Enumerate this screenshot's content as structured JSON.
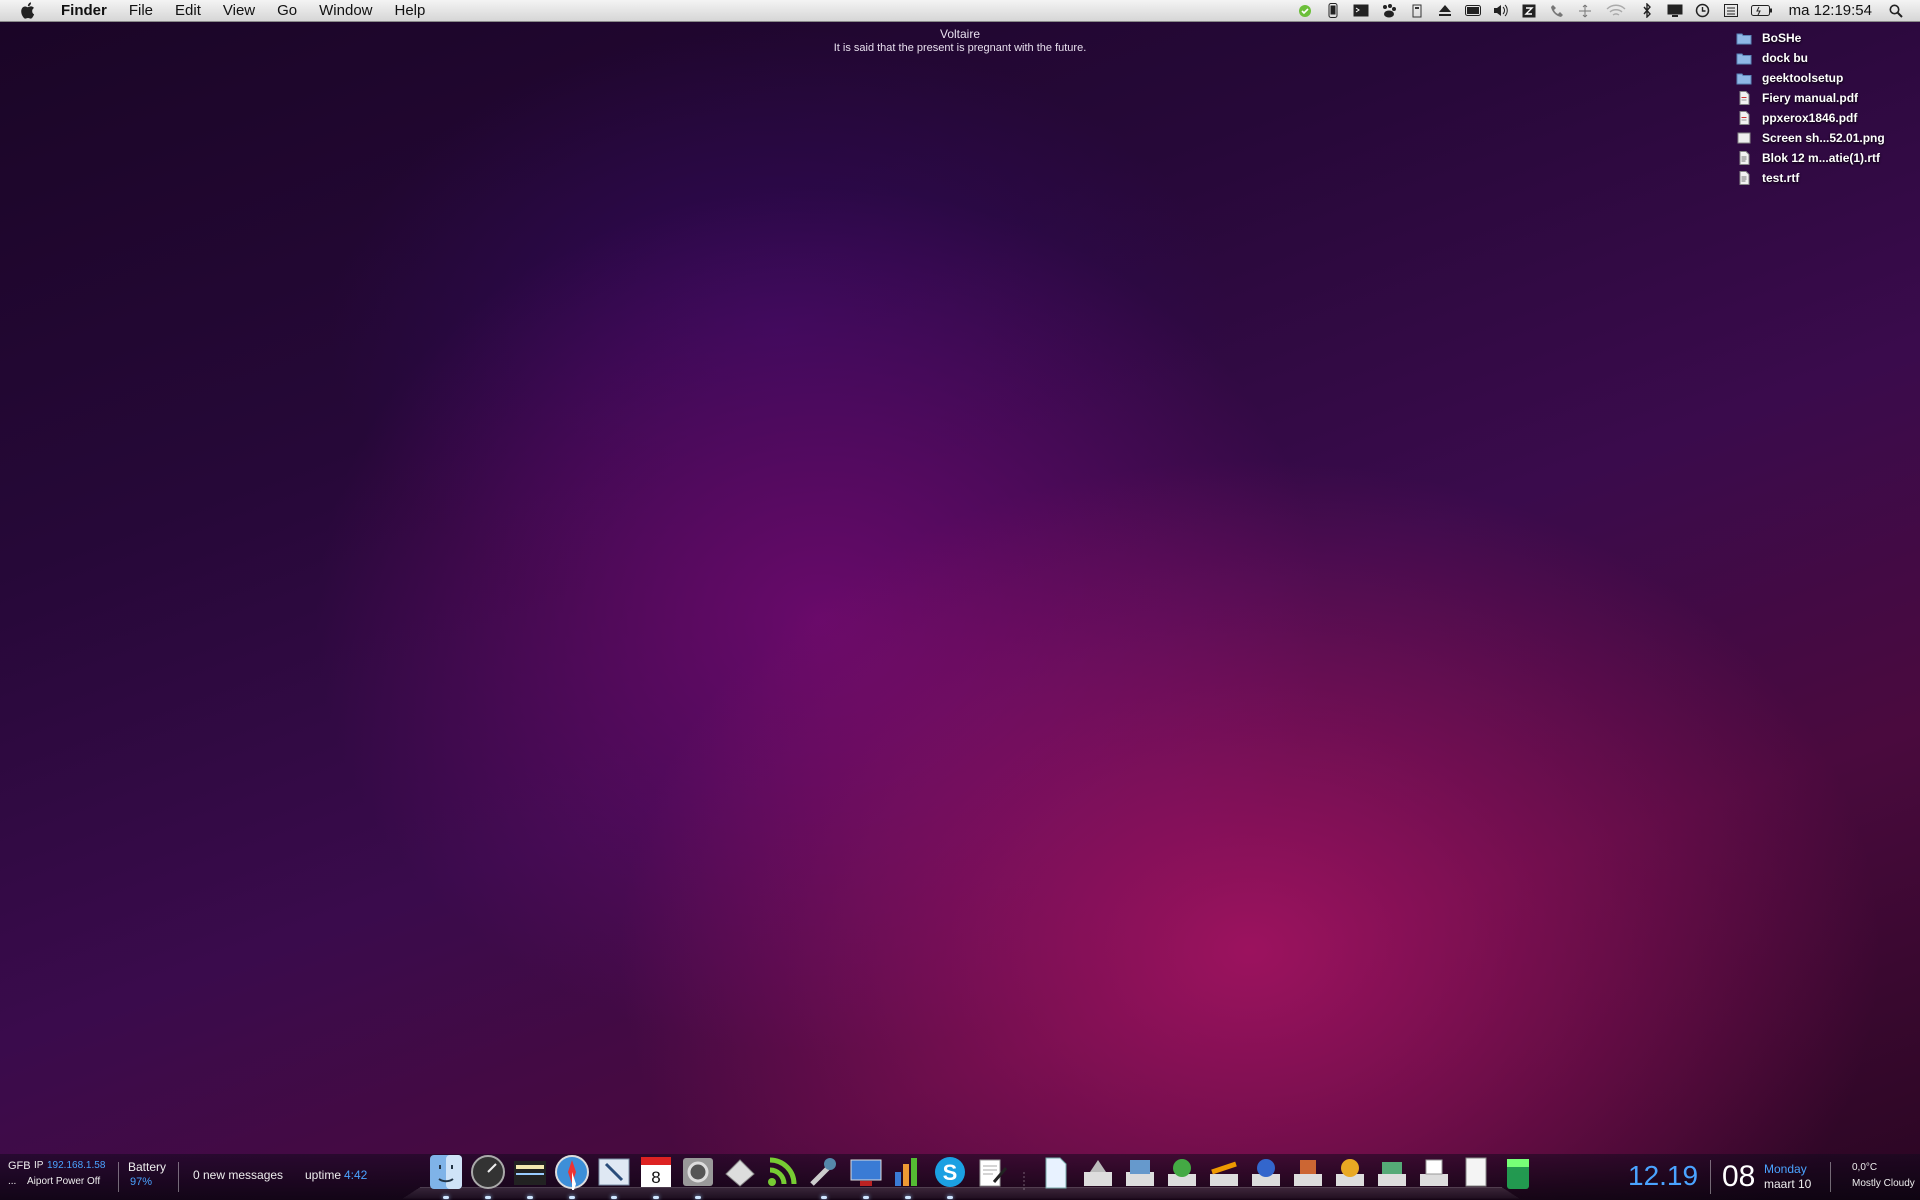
{
  "menubar": {
    "apple_icon": "apple-logo-icon",
    "app_name": "Finder",
    "menus": [
      "File",
      "Edit",
      "View",
      "Go",
      "Window",
      "Help"
    ],
    "status_icons": [
      "evernote-icon",
      "iphone-icon",
      "terminal-icon",
      "growl-paw-icon",
      "battery-monitor-icon",
      "eject-icon",
      "battery-bar-icon",
      "volume-icon",
      "dropbox-icon",
      "phone-icon",
      "network-arrows-icon",
      "wifi-icon",
      "bluetooth-icon",
      "display-icon",
      "time-machine-icon",
      "keyboard-icon",
      "battery-charging-icon"
    ],
    "clock": "ma 12:19:54",
    "spotlight_icon": "spotlight-search-icon"
  },
  "quote": {
    "author": "Voltaire",
    "text": "It is said that the present is pregnant with the future."
  },
  "desktop": {
    "files": [
      {
        "name": "BoSHe",
        "icon": "folder-icon"
      },
      {
        "name": "dock bu",
        "icon": "folder-icon"
      },
      {
        "name": "geektoolsetup",
        "icon": "folder-icon"
      },
      {
        "name": "Fiery manual.pdf",
        "icon": "pdf-document-icon"
      },
      {
        "name": "ppxerox1846.pdf",
        "icon": "pdf-document-icon"
      },
      {
        "name": "Screen sh...52.01.png",
        "icon": "image-file-icon"
      },
      {
        "name": "Blok 12 m...atie(1).rtf",
        "icon": "rtf-document-icon"
      },
      {
        "name": "test.rtf",
        "icon": "rtf-document-icon"
      }
    ]
  },
  "bottombar": {
    "network_label": "GFB",
    "ip_label": "IP",
    "ip_value": "192.168.1.58",
    "airport_prefix": "...",
    "airport_status": "Aiport Power Off",
    "battery_label": "Battery",
    "battery_value": "97%",
    "mail_status": "0 new messages",
    "uptime_label": "uptime",
    "uptime_value": "4:42",
    "time_big": "12.19",
    "day_number": "08",
    "weekday": "Monday",
    "month_year": "maart 10",
    "temperature": "0,0°C",
    "weather": "Mostly Cloudy"
  },
  "dock": {
    "apps": [
      "finder-icon",
      "dashboard-icon",
      "preview-folder-icon",
      "safari-icon",
      "mail-icon",
      "ical-icon",
      "system-preferences-icon",
      "papers-icon",
      "rss-feed-icon",
      "xcode-tools-icon",
      "keynote-icon",
      "numbers-icon",
      "skype-icon",
      "textedit-icon"
    ],
    "stacks": [
      "documents-stack-icon",
      "applications-stack-icon",
      "pictures-stack-icon",
      "utility-stack-icon",
      "drawing-stack-icon",
      "downloads-stack-icon",
      "safari-downloads-icon",
      "archive-stack-icon",
      "coins-stack-icon",
      "printer-stack-icon",
      "papers-stack-icon",
      "trash-icon"
    ],
    "running": [
      0,
      1,
      2,
      3,
      4,
      5,
      6,
      9,
      10,
      11,
      12
    ]
  },
  "colors": {
    "accent_blue": "#4aa3ff",
    "menubar_bg": "#e6e6e6",
    "wallpaper_magenta": "#aa1464",
    "wallpaper_purple": "#3a0b4c"
  }
}
